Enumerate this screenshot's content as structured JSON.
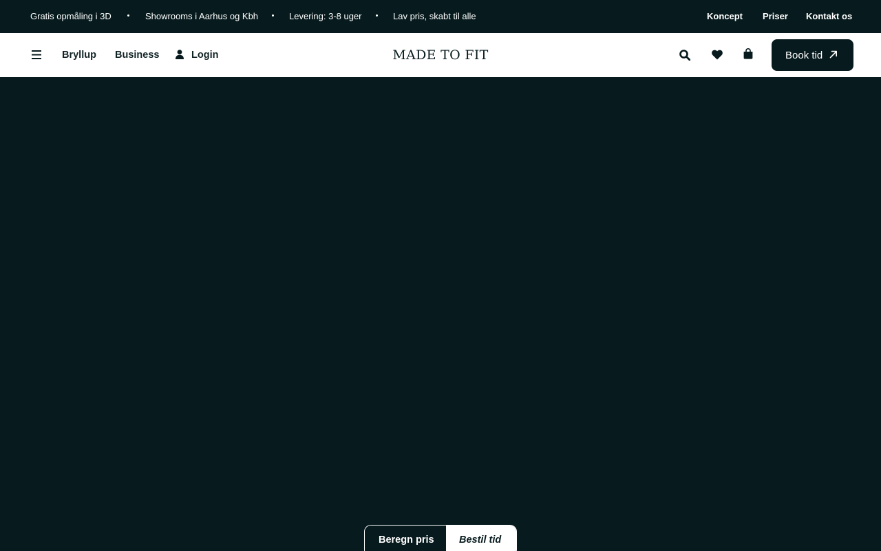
{
  "colors": {
    "dark": "#071a1d",
    "white": "#ffffff",
    "nav_text": "#122326"
  },
  "topbar": {
    "usps": [
      "Gratis opmåling i 3D",
      "Showrooms i Aarhus og Kbh",
      "Levering: 3-8 uger",
      "Lav pris, skabt til alle"
    ],
    "links": [
      "Koncept",
      "Priser",
      "Kontakt os"
    ]
  },
  "navbar": {
    "menu_icon": "hamburger-menu-icon",
    "links": [
      "Bryllup",
      "Business"
    ],
    "login_icon": "user-icon",
    "login_label": "Login",
    "logo": "MADE TO FIT",
    "icons": [
      "search-icon",
      "heart-icon",
      "shopping-bag-icon"
    ],
    "book_button": {
      "label": "Book tid",
      "icon": "arrow-up-right-icon"
    }
  },
  "toggle": {
    "left_label": "Beregn pris",
    "right_label": "Bestil tid"
  }
}
